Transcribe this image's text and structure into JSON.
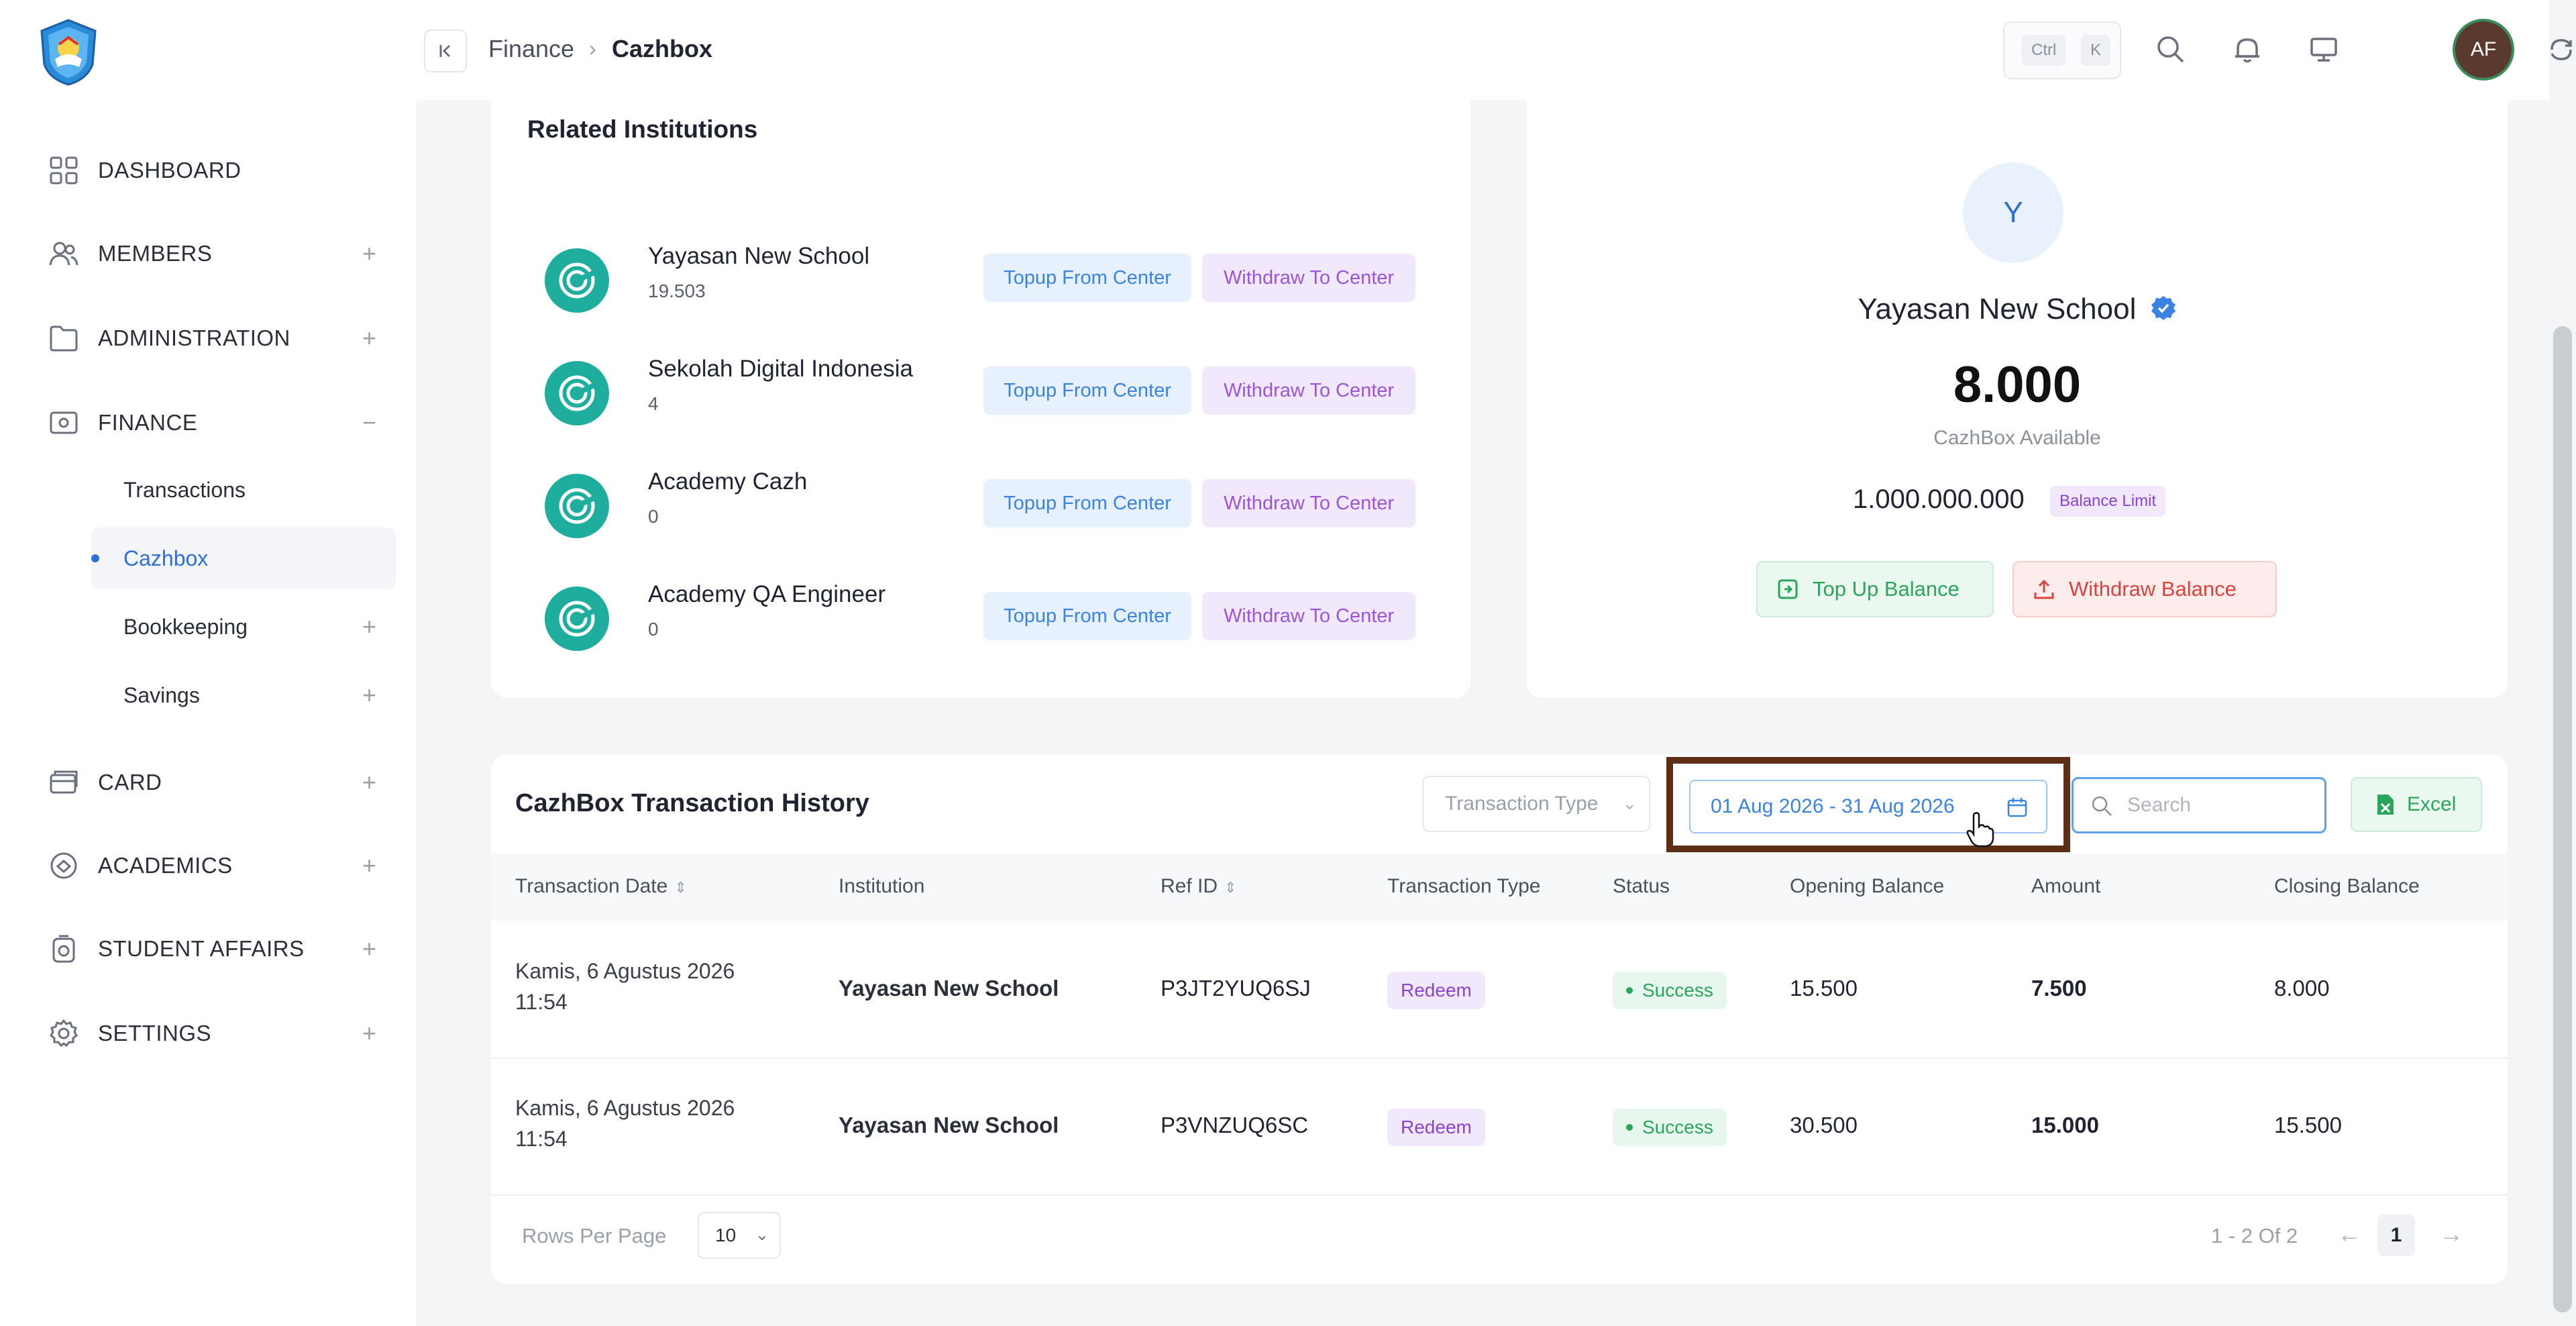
{
  "sidebar": {
    "logo_icon": "school-emblem-icon",
    "items": [
      {
        "label": "DASHBOARD",
        "icon": "grid-icon",
        "expander": ""
      },
      {
        "label": "MEMBERS",
        "icon": "users-icon",
        "expander": "+"
      },
      {
        "label": "ADMINISTRATION",
        "icon": "folder-icon",
        "expander": "+"
      },
      {
        "label": "FINANCE",
        "icon": "wallet-icon",
        "expander": "−"
      },
      {
        "label": "CARD",
        "icon": "card-icon",
        "expander": "+"
      },
      {
        "label": "ACADEMICS",
        "icon": "academics-icon",
        "expander": "+"
      },
      {
        "label": "STUDENT AFFAIRS",
        "icon": "student-affairs-icon",
        "expander": "+"
      },
      {
        "label": "SETTINGS",
        "icon": "gear-icon",
        "expander": "+"
      }
    ],
    "finance_sub": [
      {
        "label": "Transactions",
        "expander": ""
      },
      {
        "label": "Cazhbox",
        "expander": ""
      },
      {
        "label": "Bookkeeping",
        "expander": "+"
      },
      {
        "label": "Savings",
        "expander": "+"
      }
    ]
  },
  "topbar": {
    "breadcrumb": [
      "Finance",
      "›",
      "Cazhbox"
    ],
    "shortcut": [
      "Ctrl",
      "K"
    ],
    "avatar_initials": "AF"
  },
  "related": {
    "title": "Related Institutions",
    "topup_label": "Topup From Center",
    "withdraw_label": "Withdraw To Center",
    "institutions": [
      {
        "name": "Yayasan New School",
        "balance": "19.503"
      },
      {
        "name": "Sekolah Digital Indonesia",
        "balance": "4"
      },
      {
        "name": "Academy Cazh",
        "balance": "0"
      },
      {
        "name": "Academy QA Engineer",
        "balance": "0"
      }
    ]
  },
  "balance_card": {
    "initial": "Y",
    "name": "Yayasan New School",
    "amount": "8.000",
    "available_label": "CazhBox Available",
    "limit_value": "1.000.000.000",
    "limit_label": "Balance Limit",
    "topup_button": "Top Up Balance",
    "withdraw_button": "Withdraw Balance"
  },
  "history": {
    "title": "CazhBox Transaction History",
    "type_placeholder": "Transaction Type",
    "date_range": "01 Aug 2026 - 31 Aug 2026",
    "search_placeholder": "Search",
    "excel_label": "Excel",
    "columns": [
      "Transaction Date",
      "Institution",
      "Ref ID",
      "Transaction Type",
      "Status",
      "Opening Balance",
      "Amount",
      "Closing Balance"
    ],
    "rows": [
      {
        "date1": "Kamis, 6 Agustus 2026",
        "date2": "11:54",
        "institution": "Yayasan New School",
        "ref": "P3JT2YUQ6SJ",
        "type": "Redeem",
        "status": "Success",
        "opening": "15.500",
        "amount": "7.500",
        "closing": "8.000"
      },
      {
        "date1": "Kamis, 6 Agustus 2026",
        "date2": "11:54",
        "institution": "Yayasan New School",
        "ref": "P3VNZUQ6SC",
        "type": "Redeem",
        "status": "Success",
        "opening": "30.500",
        "amount": "15.000",
        "closing": "15.500"
      }
    ],
    "rows_per_page_label": "Rows Per Page",
    "rows_per_page": "10",
    "page_info": "1 - 2 Of 2",
    "current_page": "1"
  },
  "colors": {
    "accent": "#2d6fd6",
    "success": "#2aa65c",
    "danger": "#d9453d",
    "purple": "#8a44cf",
    "highlight_frame": "#5c2f16"
  }
}
